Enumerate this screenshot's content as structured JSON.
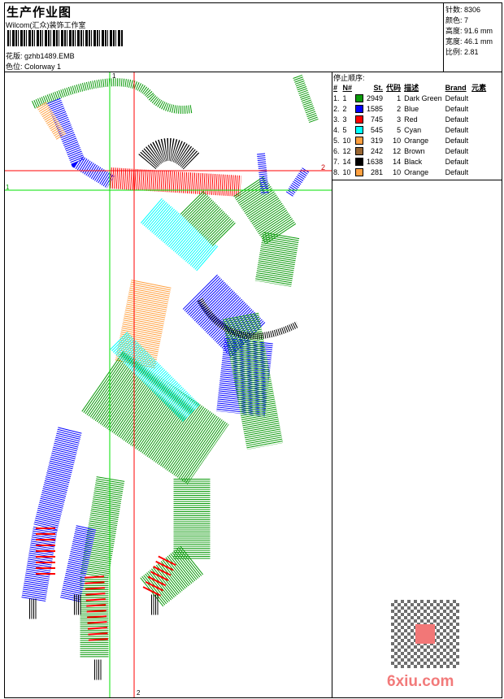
{
  "header": {
    "title": "生产作业图",
    "company": "Wilcom(汇众)装饰工作室",
    "design_label": "花版:",
    "design_file": "gzhb1489.EMB",
    "colorway_label": "色位:",
    "colorway": "Colorway 1"
  },
  "stats": [
    {
      "label": "针数:",
      "value": "8306"
    },
    {
      "label": "颜色:",
      "value": "7"
    },
    {
      "label": "高度:",
      "value": "91.6 mm"
    },
    {
      "label": "宽度:",
      "value": "46.1 mm"
    },
    {
      "label": "比例:",
      "value": "2.81"
    }
  ],
  "stop_sequence": {
    "title": "停止顺序:",
    "columns": [
      "#",
      "N#",
      "St.",
      "代码",
      "描述",
      "Brand",
      "元素"
    ],
    "rows": [
      {
        "idx": "1.",
        "n": "1",
        "color": "#0a9a0a",
        "st": "2949",
        "code": "1",
        "desc": "Dark Green",
        "brand": "Default"
      },
      {
        "idx": "2.",
        "n": "2",
        "color": "#0000ff",
        "st": "1585",
        "code": "2",
        "desc": "Blue",
        "brand": "Default"
      },
      {
        "idx": "3.",
        "n": "3",
        "color": "#ff0000",
        "st": "745",
        "code": "3",
        "desc": "Red",
        "brand": "Default"
      },
      {
        "idx": "4.",
        "n": "5",
        "color": "#00ffff",
        "st": "545",
        "code": "5",
        "desc": "Cyan",
        "brand": "Default"
      },
      {
        "idx": "5.",
        "n": "10",
        "color": "#ffa040",
        "st": "319",
        "code": "10",
        "desc": "Orange",
        "brand": "Default"
      },
      {
        "idx": "6.",
        "n": "12",
        "color": "#996633",
        "st": "242",
        "code": "12",
        "desc": "Brown",
        "brand": "Default"
      },
      {
        "idx": "7.",
        "n": "14",
        "color": "#000000",
        "st": "1638",
        "code": "14",
        "desc": "Black",
        "brand": "Default"
      },
      {
        "idx": "8.",
        "n": "10",
        "color": "#ffa040",
        "st": "281",
        "code": "10",
        "desc": "Orange",
        "brand": "Default"
      }
    ]
  },
  "guides": {
    "green_label": "1",
    "red_label": "2"
  },
  "watermark": "6xiu.com"
}
